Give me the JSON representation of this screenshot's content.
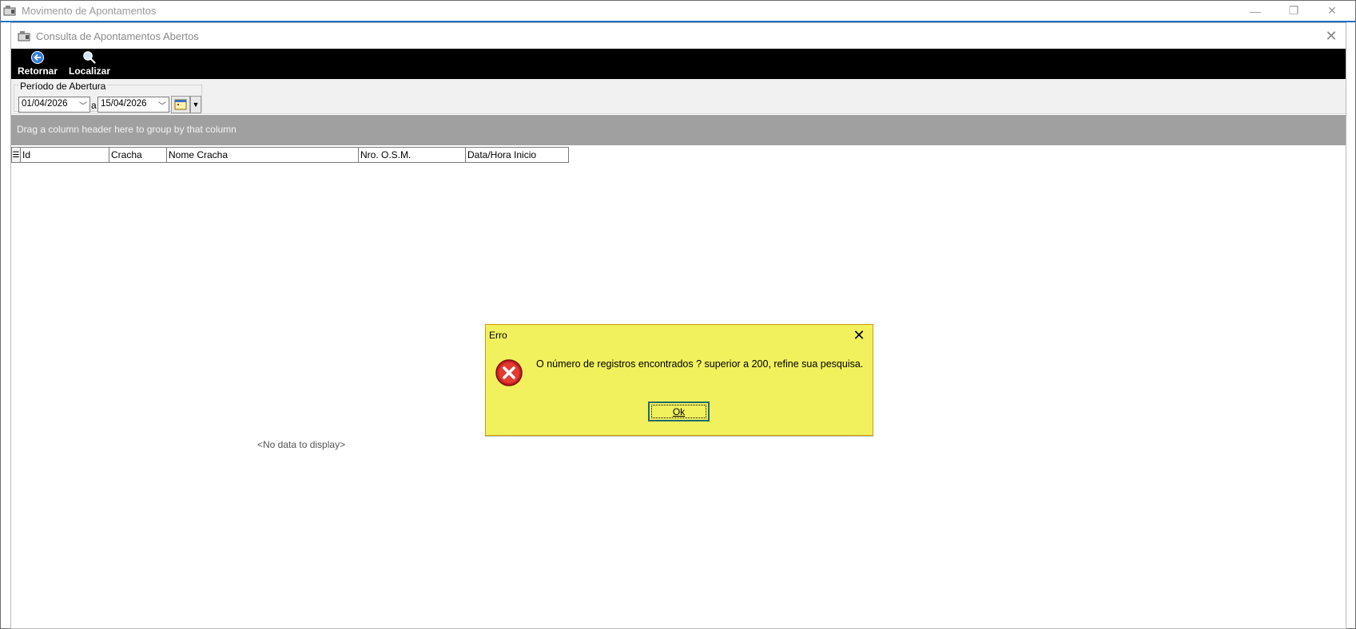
{
  "outer_window": {
    "title": "Movimento de Apontamentos",
    "minimize_glyph": "—",
    "maximize_glyph": "❐",
    "close_glyph": "✕"
  },
  "inner_window": {
    "title": "Consulta de Apontamentos Abertos",
    "close_glyph": "✕"
  },
  "toolbar": {
    "retornar_label": "Retornar",
    "localizar_label": "Localizar"
  },
  "filter": {
    "group_label": "Período de Abertura",
    "date_from": "01/04/2026",
    "separator": "a",
    "date_to": "15/04/2026"
  },
  "group_panel": {
    "hint": "Drag a column header here to group by that column"
  },
  "grid": {
    "columns": [
      "Id",
      "Cracha",
      "Nome Cracha",
      "Nro. O.S.M.",
      "Data/Hora Inicio"
    ],
    "empty_text": "<No data to display>"
  },
  "dialog": {
    "title": "Erro",
    "message": "O número de registros encontrados ? superior a 200, refine sua pesquisa.",
    "ok_label": "Ok",
    "close_glyph": "✕"
  },
  "colors": {
    "toolbar_bg": "#000000",
    "group_panel_bg": "#a0a0a0",
    "dialog_bg": "#f1f15e",
    "accent_blue": "#1a6fc4",
    "error_red": "#c8201e"
  }
}
